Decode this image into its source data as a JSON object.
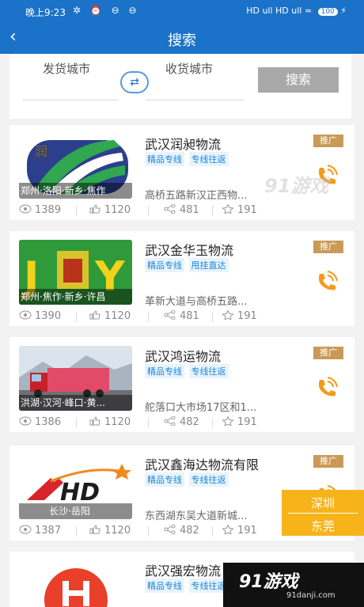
{
  "status_bar": {
    "time": "晚上9:23",
    "left_icons": "✲ ⏰ ⊖ ⊖",
    "right_signal": "HD ull HD ull ≈",
    "battery": "100",
    "charging": "⚡"
  },
  "navbar": {
    "back_icon": "‹",
    "title": "搜索"
  },
  "search": {
    "from_label": "发货城市",
    "to_label": "收货城市",
    "swap_icon": "⇄",
    "button_label": "搜索"
  },
  "listings": [
    {
      "name": "武汉润昶物流",
      "tags": [
        "精品专线",
        "专线往返"
      ],
      "promo": "推广",
      "caption": "郑州·洛阳·新乡·焦作",
      "address": "高桥五路新汉正西物...",
      "views": "1389",
      "likes": "1120",
      "shares": "481",
      "favorites": "191",
      "thumb_type": "logo1"
    },
    {
      "name": "武汉金华玉物流",
      "tags": [
        "精品专线",
        "甩挂直达"
      ],
      "promo": "推广",
      "caption": "郑州·焦作·新乡·许昌",
      "address": "革新大道与高桥五路...",
      "views": "1390",
      "likes": "1120",
      "shares": "481",
      "favorites": "191",
      "thumb_type": "logo2"
    },
    {
      "name": "武汉鸿运物流",
      "tags": [
        "精品专线",
        "专线往返"
      ],
      "promo": "推广",
      "caption": "洪湖·汉河·峰口·黄...",
      "address": "舵落口大市场17区和1...",
      "views": "1386",
      "likes": "1120",
      "shares": "482",
      "favorites": "191",
      "thumb_type": "truck"
    },
    {
      "name": "武汉鑫海达物流有限",
      "tags": [
        "精品专线",
        "专线往返"
      ],
      "promo": "推广",
      "caption": "长沙·岳阳",
      "address": "东西湖东吴大道新城...",
      "views": "1387",
      "likes": "1120",
      "shares": "482",
      "favorites": "191",
      "thumb_type": "hd"
    },
    {
      "name": "武汉强宏物流",
      "tags": [
        "精品专线",
        "专线往返"
      ],
      "promo": "",
      "caption": "",
      "address": "",
      "views": "",
      "likes": "",
      "shares": "",
      "favorites": "",
      "thumb_type": "h"
    }
  ],
  "float_cities": {
    "city_1": "深圳",
    "city_2": "东莞"
  },
  "watermarks": {
    "mid": "91游戏",
    "bottom_title": "91游戏",
    "bottom_url": "91danji.com"
  },
  "colors": {
    "primary_blue": "#1a72c9",
    "promo_gold": "#c99a57",
    "phone_orange": "#f59a1b",
    "float_yellow": "#f7b31a"
  }
}
